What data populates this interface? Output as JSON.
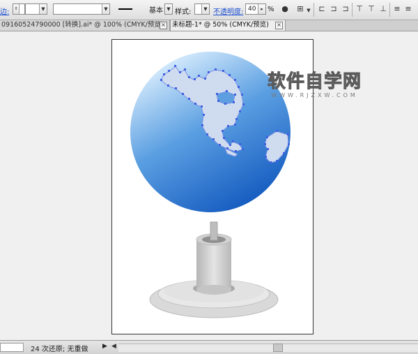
{
  "control_bar": {
    "stroke_label": "边:",
    "stroke_profile": "基本",
    "style_label": "样式:",
    "opacity_label": "不透明度:",
    "opacity_value": "40",
    "opacity_unit": "%"
  },
  "tabs": [
    {
      "label": "09160524790000 [转换].ai* @ 100% (CMYK/预览)",
      "active": false
    },
    {
      "label": "未标题-1* @ 50% (CMYK/预览)",
      "active": true
    }
  ],
  "watermark": {
    "title": "软件自学网",
    "subtitle": "WWW.RJZXW.COM"
  },
  "status_bar": {
    "undo_text": "24 次还原; 无重做"
  },
  "colors": {
    "globe_light": "#cfe6fb",
    "globe_dark": "#1c62c4",
    "continent": "#cddcf0",
    "anchor": "#4060e0",
    "stand": "#d6d6d6"
  }
}
